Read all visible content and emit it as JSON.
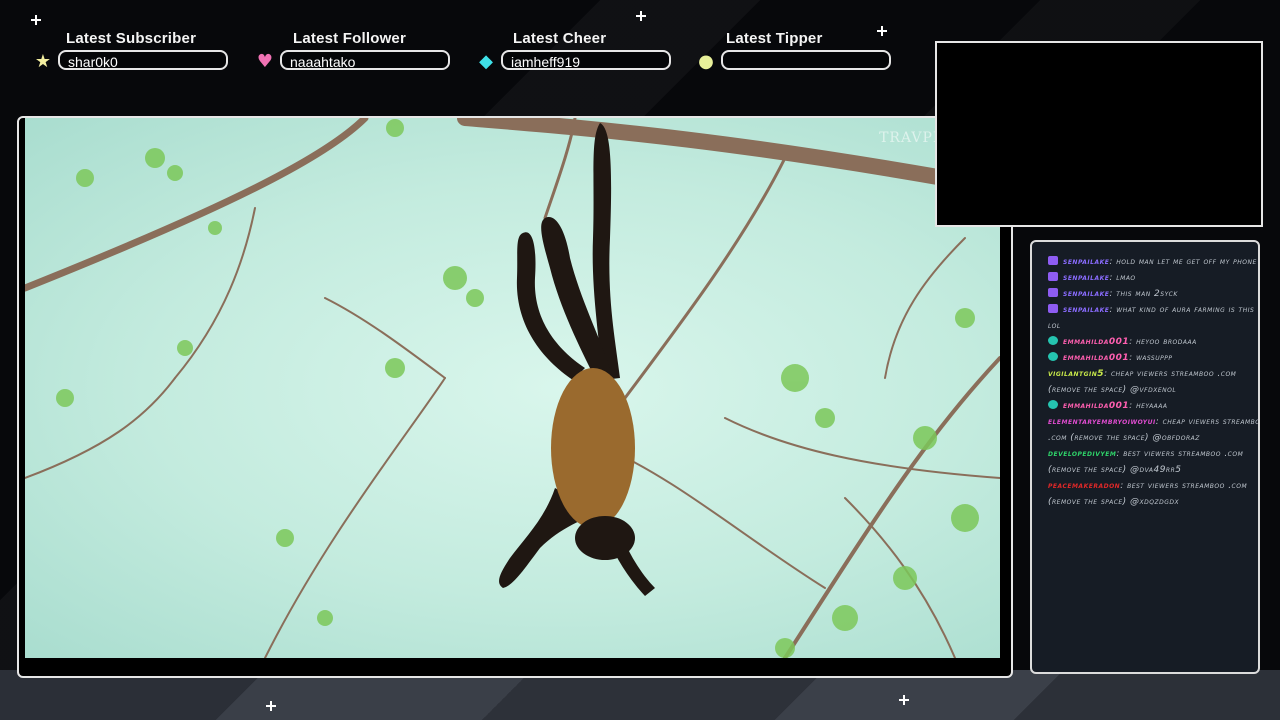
{
  "stats": [
    {
      "title": "Latest Subscriber",
      "value": "shar0k0",
      "icon": "star-icon",
      "icon_color": "#f3efa0"
    },
    {
      "title": "Latest Follower",
      "value": "naaahtako",
      "icon": "heart-icon",
      "icon_color": "#f072b4"
    },
    {
      "title": "Latest Cheer",
      "value": "iamheff919",
      "icon": "diamond-icon",
      "icon_color": "#3fe0e8"
    },
    {
      "title": "Latest Tipper",
      "value": "",
      "icon": "coin-icon",
      "icon_color": "#e8f09a"
    }
  ],
  "video": {
    "watermark": "TRAVPEDIA"
  },
  "chat": {
    "messages": [
      {
        "user": "senpailake",
        "color": "#8a6cff",
        "badge": "purple",
        "text": "hold man let me get off my phone"
      },
      {
        "user": "senpailake",
        "color": "#8a6cff",
        "badge": "purple",
        "text": "lmao"
      },
      {
        "user": "senpailake",
        "color": "#8a6cff",
        "badge": "purple",
        "text": "this man 2syck"
      },
      {
        "user": "senpailake",
        "color": "#8a6cff",
        "badge": "purple",
        "text": "what kind of aura farming is this lol"
      },
      {
        "user": "emmahilda001",
        "color": "#ff5fb0",
        "badge": "teal",
        "text": "heyoo brodaaa"
      },
      {
        "user": "emmahilda001",
        "color": "#ff5fb0",
        "badge": "teal",
        "text": "wassuppp"
      },
      {
        "user": "vigilantgin5",
        "color": "#c8e84a",
        "badge": "",
        "text": "Cheap viewers streamboo .com (remove the space) @vFdxenoL"
      },
      {
        "user": "emmahilda001",
        "color": "#ff5fb0",
        "badge": "teal",
        "text": "Heyaaaa"
      },
      {
        "user": "elementaryembryoiwoyui",
        "color": "#e04cd0",
        "badge": "",
        "text": "Cheap viewers streamboo .com (remove the space) @obFdoRaZ"
      },
      {
        "user": "developedivyem",
        "color": "#2fd46a",
        "badge": "",
        "text": "Best viewers streamboo .com (remove the space) @dva49Rr5"
      },
      {
        "user": "peacemakeradon",
        "color": "#e02828",
        "badge": "",
        "text": "Best viewers streamboo .com (remove the space) @XDQzDGdx"
      }
    ]
  }
}
